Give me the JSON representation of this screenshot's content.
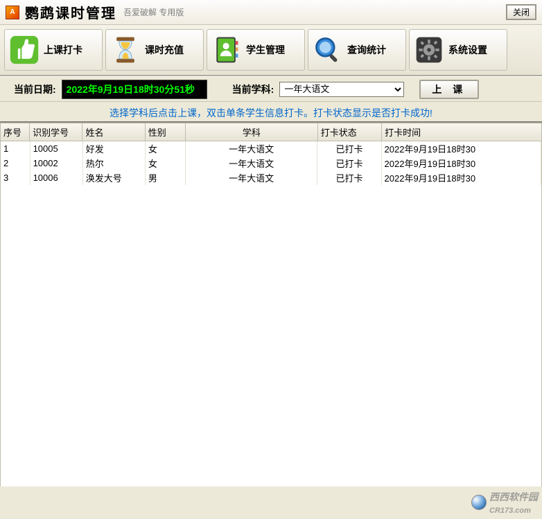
{
  "title": {
    "main": "鹦鹉课时管理",
    "sub": "吾爱破解 专用版",
    "close": "关闭"
  },
  "toolbar": [
    {
      "id": "attend",
      "label": "上课打卡",
      "icon": "thumbs-up-icon"
    },
    {
      "id": "recharge",
      "label": "课时充值",
      "icon": "hourglass-icon"
    },
    {
      "id": "students",
      "label": "学生管理",
      "icon": "address-book-icon"
    },
    {
      "id": "stats",
      "label": "查询统计",
      "icon": "magnifier-icon"
    },
    {
      "id": "settings",
      "label": "系统设置",
      "icon": "gear-icon"
    }
  ],
  "control": {
    "date_label": "当前日期:",
    "date_value": "2022年9月19日18时30分51秒",
    "subject_label": "当前学科:",
    "subject_value": "一年大语文",
    "class_button": "上 课"
  },
  "hint": "选择学科后点击上课，双击单条学生信息打卡。打卡状态显示是否打卡成功!",
  "table": {
    "headers": {
      "idx": "序号",
      "sid": "识别学号",
      "name": "姓名",
      "sex": "性别",
      "subject": "学科",
      "status": "打卡状态",
      "time": "打卡时间"
    },
    "rows": [
      {
        "idx": "1",
        "sid": "10005",
        "name": "好发",
        "sex": "女",
        "subject": "一年大语文",
        "status": "已打卡",
        "time": "2022年9月19日18时30"
      },
      {
        "idx": "2",
        "sid": "10002",
        "name": "热尔",
        "sex": "女",
        "subject": "一年大语文",
        "status": "已打卡",
        "time": "2022年9月19日18时30"
      },
      {
        "idx": "3",
        "sid": "10006",
        "name": "涣发大号",
        "sex": "男",
        "subject": "一年大语文",
        "status": "已打卡",
        "time": "2022年9月19日18时30"
      }
    ]
  },
  "watermark": {
    "brand": "西西软件园",
    "url": "CR173.com"
  }
}
